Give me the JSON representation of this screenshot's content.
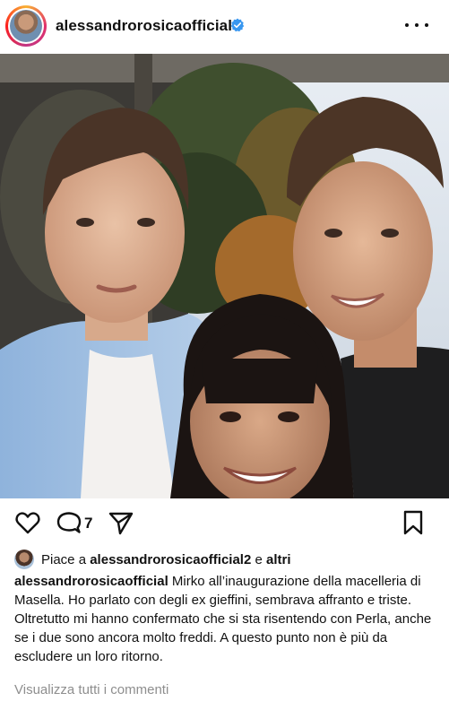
{
  "post": {
    "username": "alessandrorosicaofficial",
    "verified": true,
    "more_icon": "more-horizontal-icon"
  },
  "actions": {
    "like_icon": "heart-outline-icon",
    "comment_icon": "comment-bubble-icon",
    "comment_count": "7",
    "share_icon": "send-paper-plane-icon",
    "save_icon": "bookmark-outline-icon"
  },
  "likes": {
    "prefix": "Piace a",
    "liker": "alessandrorosicaofficial2",
    "joiner": "e",
    "others": "altri"
  },
  "caption": {
    "username": "alessandrorosicaofficial",
    "text": "Mirko all’inaugurazione della macelleria di Masella. Ho parlato con degli ex gieffini, sembrava affranto e triste. Oltretutto mi hanno confermato che si sta risentendo con Perla, anche se i due sono ancora molto freddi. A questo punto non è più da escludere un loro ritorno."
  },
  "view_comments": "Visualizza tutti i commenti",
  "colors": {
    "verified_blue": "#3897f0",
    "text": "#111111",
    "muted": "#8e8e8e"
  }
}
